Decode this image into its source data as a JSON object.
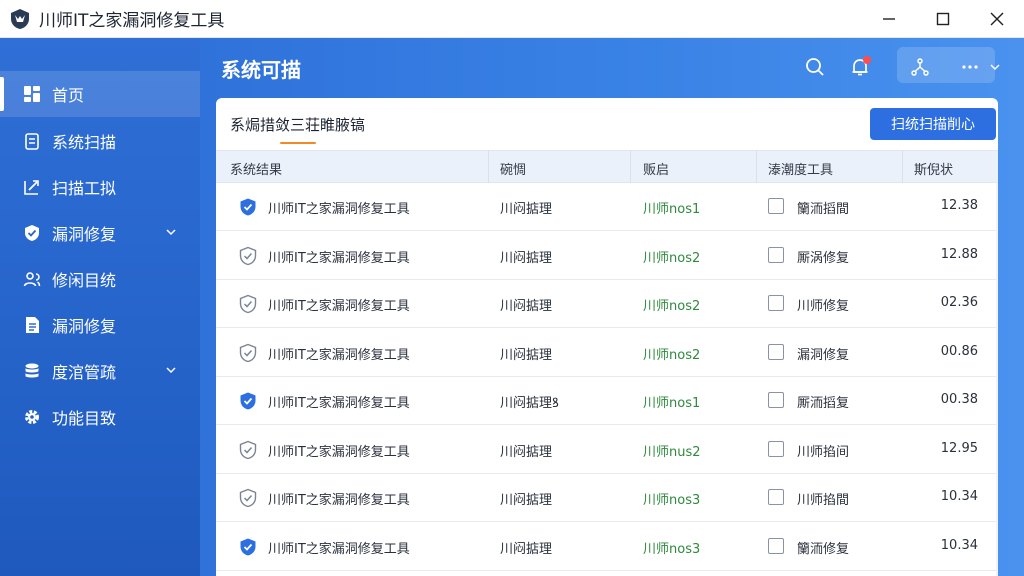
{
  "window": {
    "title": "川师IT之家漏洞修复工具"
  },
  "sidebar": {
    "items": [
      {
        "label": "首页",
        "icon": "dashboard-icon",
        "active": true
      },
      {
        "label": "系统扫描",
        "icon": "clipboard-icon"
      },
      {
        "label": "扫描工拟",
        "icon": "edit-chart-icon"
      },
      {
        "label": "漏洞修复",
        "icon": "shield-check-icon",
        "expandable": true
      },
      {
        "label": "修闲目统",
        "icon": "users-icon"
      },
      {
        "label": "漏洞修复",
        "icon": "report-icon"
      },
      {
        "label": "度涫管疏",
        "icon": "database-icon",
        "expandable": true
      },
      {
        "label": "功能目致",
        "icon": "gear-icon"
      }
    ]
  },
  "header": {
    "title": "系统可描"
  },
  "card": {
    "heading": "系焗措敛三荘睢腋镐",
    "primary_button": "扫统扫描削心",
    "columns": [
      "系统结果",
      "碗惆",
      "贩启",
      "溙潮度工具",
      "斯倪状"
    ],
    "rows": [
      {
        "name": "川师IT之家漏洞修复工具",
        "col2": "川闷掂理",
        "version": "川师nos1",
        "action": "籣洏搯間",
        "value": "12.38",
        "verified": true
      },
      {
        "name": "川师IT之家漏洞修复工具",
        "col2": "川闷掂理",
        "version": "川师nos2",
        "action": "厮涡修复",
        "value": "12.88",
        "verified": false
      },
      {
        "name": "川师IT之家漏洞修复工具",
        "col2": "川闷掂理",
        "version": "川师nos2",
        "action": "川师修复",
        "value": "02.36",
        "verified": false
      },
      {
        "name": "川师IT之家漏洞修复工具",
        "col2": "川闷掂理",
        "version": "川师nos2",
        "action": "漏洞修复",
        "value": "00.86",
        "verified": false
      },
      {
        "name": "川师IT之家漏洞修复工具",
        "col2": "川闷掂理ꝸ",
        "version": "川师nos1",
        "action": "厮洏搯复",
        "value": "00.38",
        "verified": true
      },
      {
        "name": "川师IT之家漏洞修复工具",
        "col2": "川闷掂理",
        "version": "川师nus2",
        "action": "川师掐间",
        "value": "12.95",
        "verified": false
      },
      {
        "name": "川师IT之家漏洞修复工具",
        "col2": "川闷掂理",
        "version": "川师nos3",
        "action": "川师掐間",
        "value": "10.34",
        "verified": false
      },
      {
        "name": "川师IT之家漏洞修复工具",
        "col2": "川闷掂理",
        "version": "川师nos3",
        "action": "籣洏修复",
        "value": "10.34",
        "verified": true
      }
    ]
  },
  "colors": {
    "accent": "#2d6fe0",
    "sidebar": "#2563c9",
    "version_text": "#2f8a3c",
    "tab_underline": "#f08a24",
    "notification": "#ff4d4f"
  }
}
